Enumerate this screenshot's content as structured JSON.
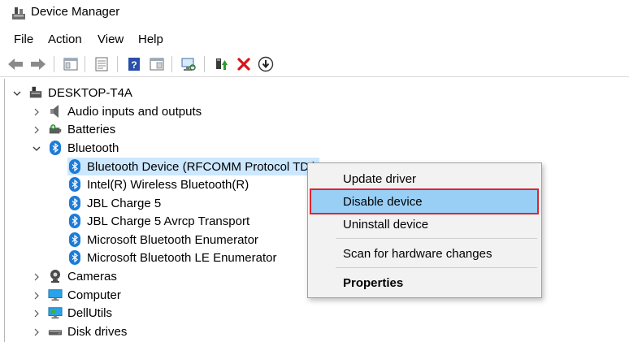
{
  "window": {
    "title": "Device Manager"
  },
  "menu": [
    "File",
    "Action",
    "View",
    "Help"
  ],
  "toolbar": {
    "buttons": [
      "back-icon",
      "forward-icon",
      "console-tree-icon",
      "properties-icon",
      "help-icon",
      "view-icon",
      "scan-icon",
      "update-driver-icon",
      "uninstall-icon",
      "download-icon"
    ]
  },
  "tree": {
    "root": "DESKTOP-T4A",
    "audio": "Audio inputs and outputs",
    "batteries": "Batteries",
    "bluetooth": "Bluetooth",
    "bt_children": [
      "Bluetooth Device (RFCOMM Protocol TDI)",
      "Intel(R) Wireless Bluetooth(R)",
      "JBL Charge 5",
      "JBL Charge 5 Avrcp Transport",
      "Microsoft Bluetooth Enumerator",
      "Microsoft Bluetooth LE Enumerator"
    ],
    "cameras": "Cameras",
    "computer": "Computer",
    "dellutils": "DellUtils",
    "disk": "Disk drives"
  },
  "context_menu": {
    "update": "Update driver",
    "disable": "Disable device",
    "uninstall": "Uninstall device",
    "scan": "Scan for hardware changes",
    "properties": "Properties"
  },
  "colors": {
    "highlight": "#99cff5",
    "outline": "#e0242f",
    "selected": "#cce8ff",
    "bluetooth": "#1e7bd7"
  }
}
